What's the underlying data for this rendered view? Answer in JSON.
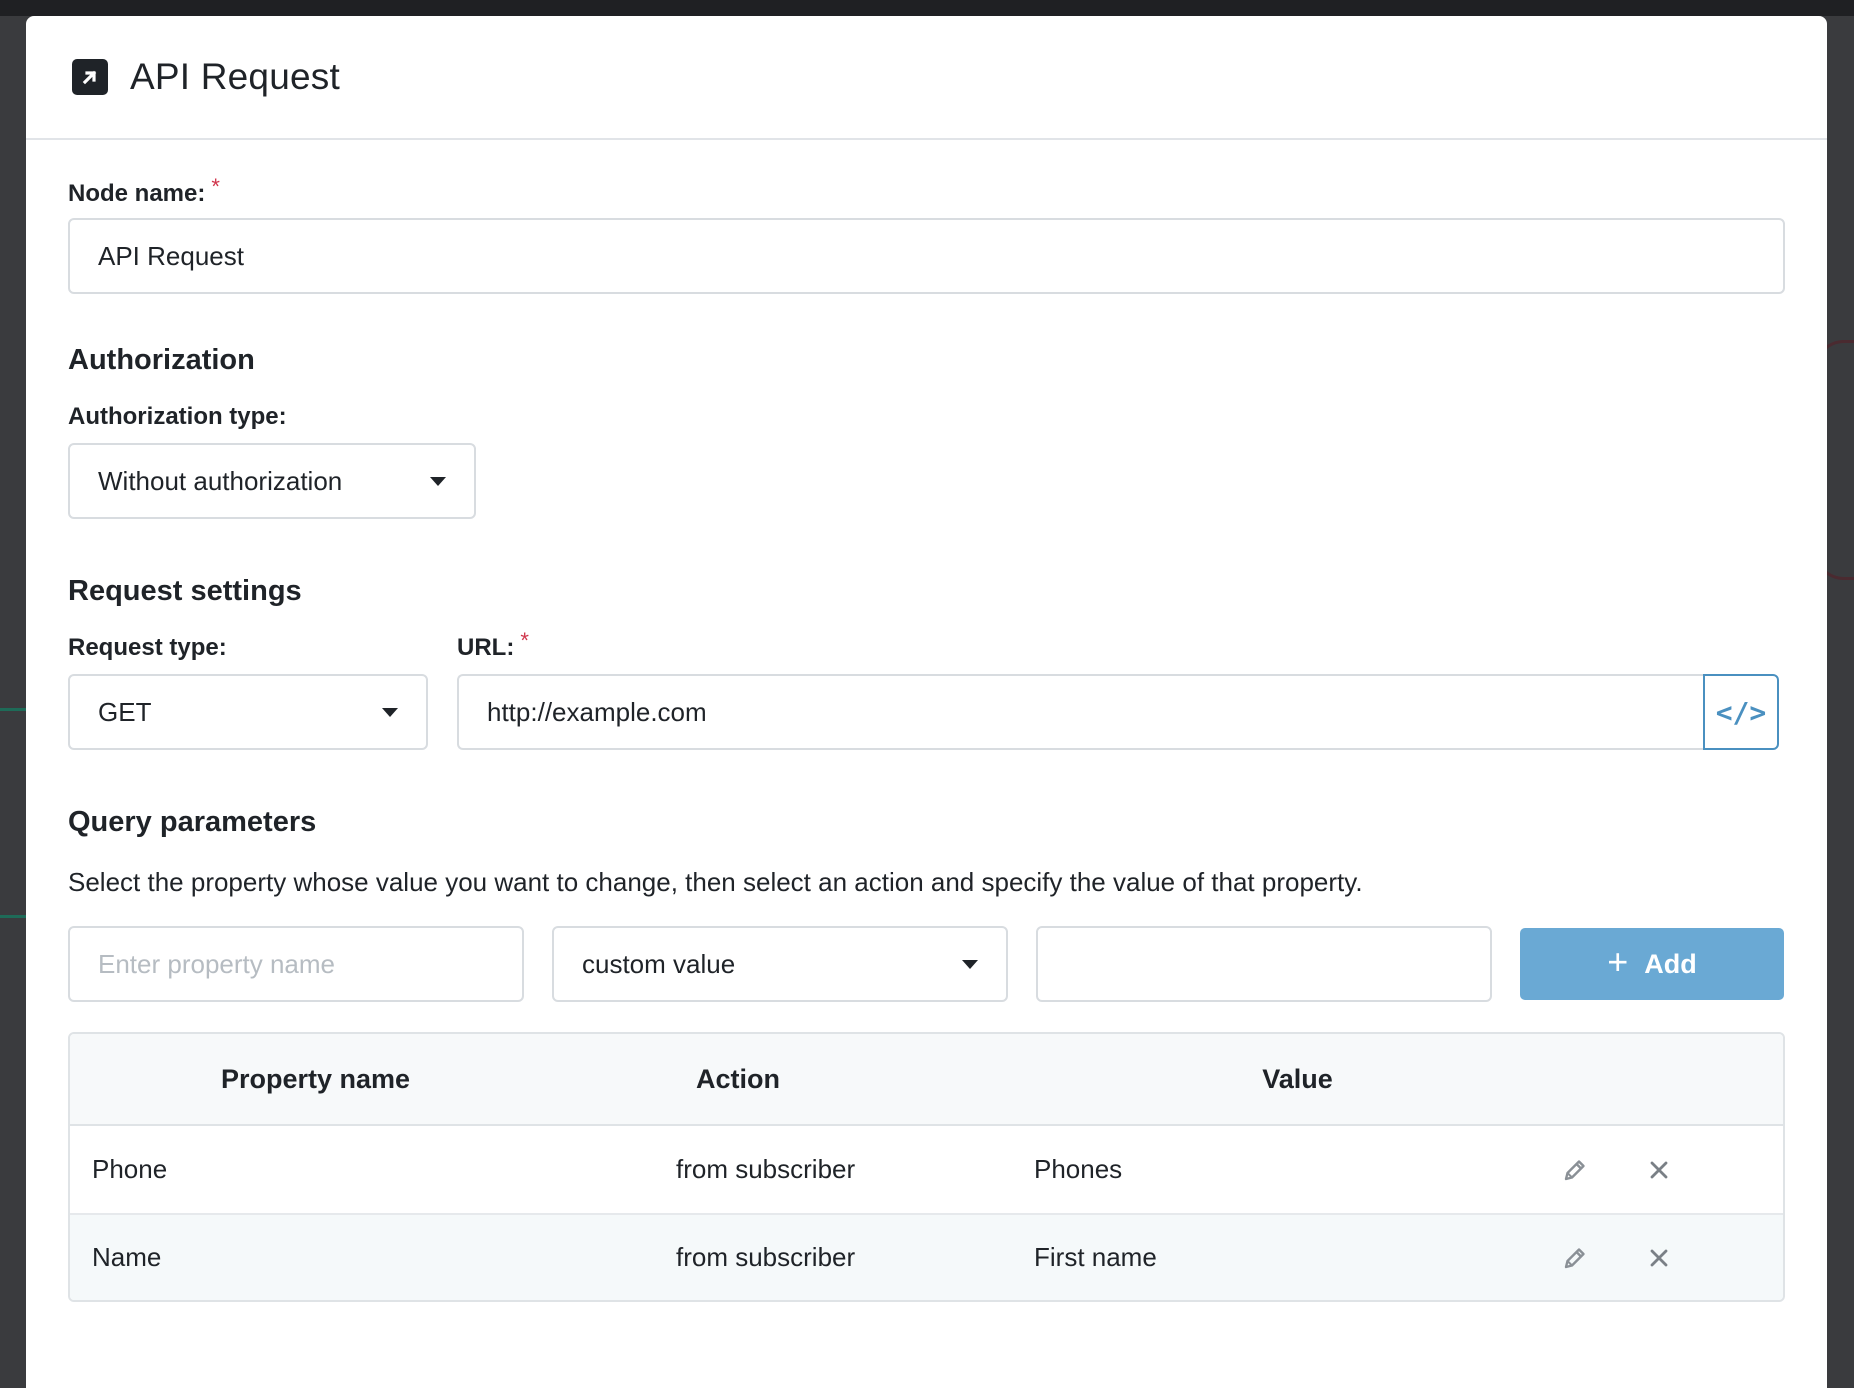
{
  "dialog": {
    "title": "API Request",
    "icon": "external-link-square-icon"
  },
  "node_name": {
    "label": "Node name:",
    "required_mark": "*",
    "value": "API Request"
  },
  "authorization": {
    "section_title": "Authorization",
    "type_label": "Authorization type:",
    "type_value": "Without authorization"
  },
  "request_settings": {
    "section_title": "Request settings",
    "request_type_label": "Request type:",
    "request_type_value": "GET",
    "url_label": "URL:",
    "url_required_mark": "*",
    "url_value": "http://example.com",
    "code_button_glyph": "</>"
  },
  "query_parameters": {
    "section_title": "Query parameters",
    "description": "Select the property whose value you want to change, then select an action and specify the value of that property.",
    "property_placeholder": "Enter property name",
    "action_value": "custom value",
    "value_input": "",
    "add_button_plus": "+",
    "add_button_label": "Add",
    "columns": [
      "Property name",
      "Action",
      "Value"
    ],
    "rows": [
      {
        "property": "Phone",
        "action": "from subscriber",
        "value": "Phones"
      },
      {
        "property": "Name",
        "action": "from subscriber",
        "value": "First name"
      }
    ]
  },
  "colors": {
    "accent": "#4a90c0",
    "add_button": "#6aa9d4",
    "required": "#d0364c"
  }
}
